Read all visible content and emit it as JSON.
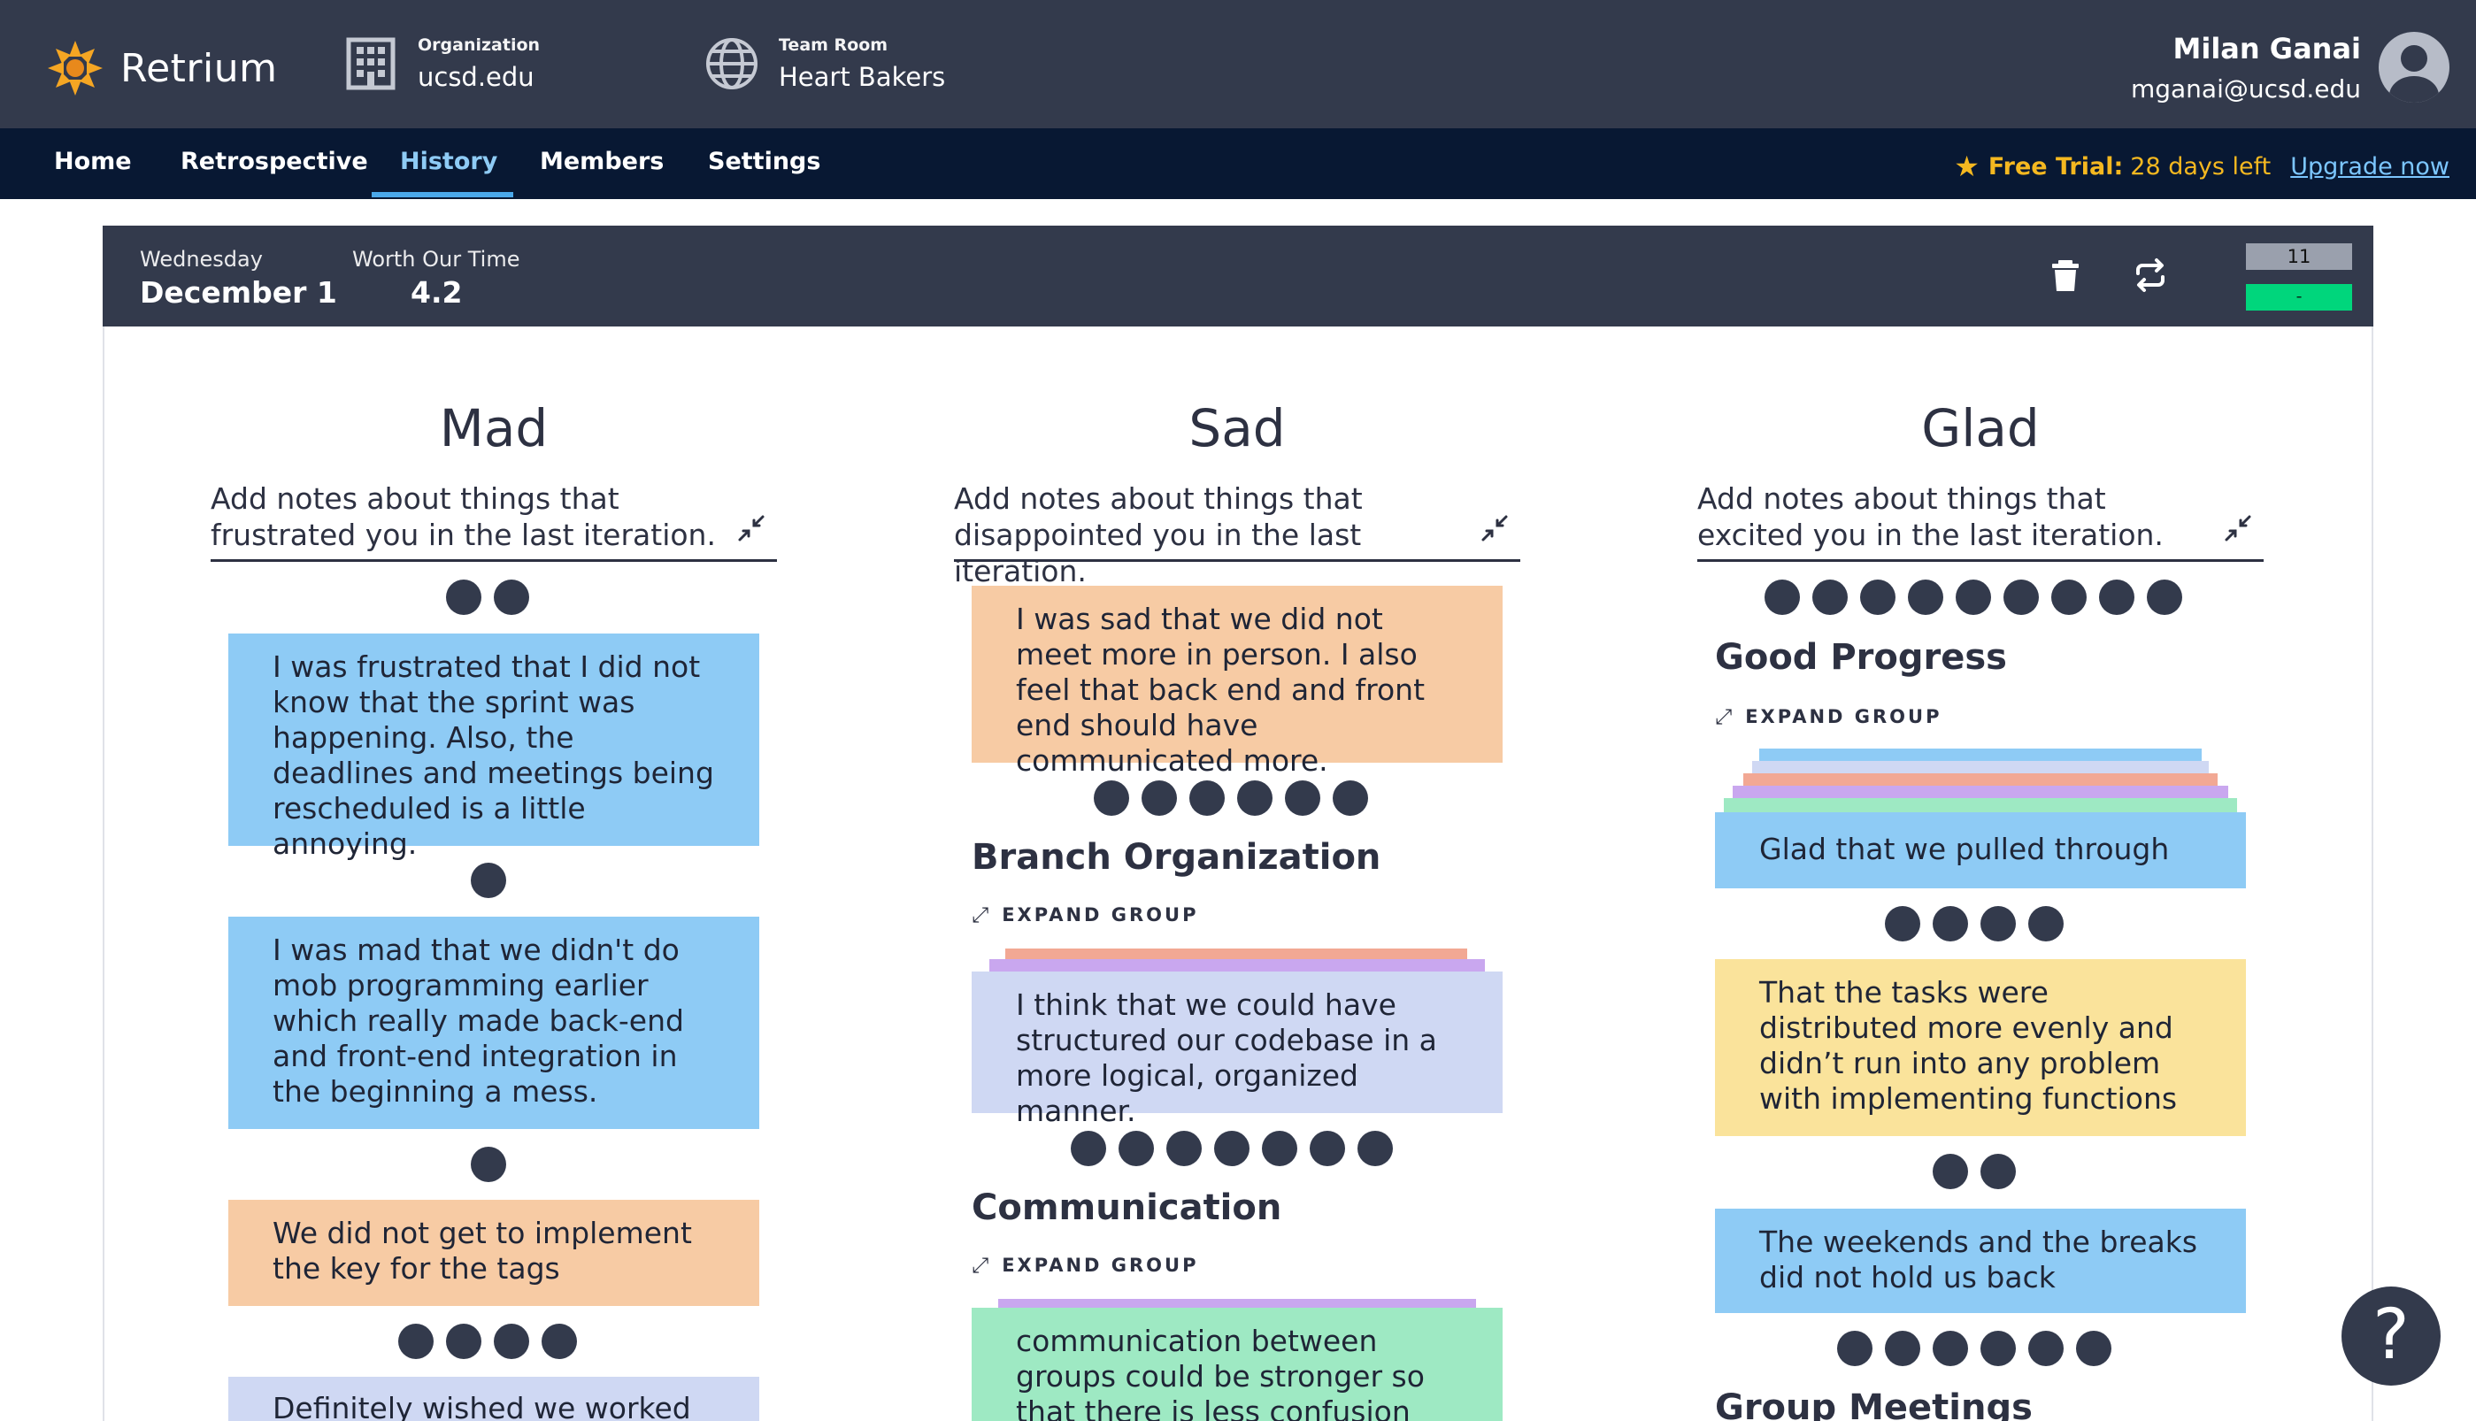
{
  "app": {
    "name": "Retrium"
  },
  "org": {
    "label": "Organization",
    "value": "ucsd.edu"
  },
  "team": {
    "label": "Team Room",
    "value": "Heart Bakers"
  },
  "user": {
    "name": "Milan Ganai",
    "email": "mganai@ucsd.edu"
  },
  "nav": {
    "items": [
      "Home",
      "Retrospective",
      "History",
      "Members",
      "Settings"
    ],
    "active": "History"
  },
  "trial": {
    "label": "Free Trial:",
    "days": "28 days left",
    "upgrade": "Upgrade now"
  },
  "retro": {
    "day": "Wednesday",
    "date": "December 1",
    "worth_label": "Worth Our Time",
    "worth_value": "4.2",
    "count": "11",
    "status": "-"
  },
  "columns": {
    "mad": {
      "title": "Mad",
      "desc": "Add notes about things that frustrated you in the last iteration.",
      "cards": [
        "I was frustrated that I did not know that the sprint was happening. Also, the deadlines and meetings being rescheduled is a little annoying.",
        "I was mad that we didn't do mob programming earlier which really made back-end and front-end integration in the beginning a mess.",
        "We did not get to implement the key for the tags",
        "Definitely wished we worked on"
      ]
    },
    "sad": {
      "title": "Sad",
      "desc": "Add notes about things that disappointed you in the last iteration.",
      "cards": [
        "I was sad that we did not meet more in person. I also feel that back end and front end should have communicated more.",
        "I think that we could have structured our codebase in a more logical, organized manner.",
        "communication between groups could be stronger so that there is less confusion"
      ],
      "groups": [
        "Branch Organization",
        "Communication"
      ]
    },
    "glad": {
      "title": "Glad",
      "desc": "Add notes about things that excited you in the last iteration.",
      "cards": [
        "Glad that we pulled through",
        "That the tasks were distributed more evenly and didn’t run into any problem with implementing functions",
        "The weekends and the breaks did not hold us back"
      ],
      "groups": [
        "Good Progress",
        "Group Meetings"
      ]
    }
  },
  "expand_label": "EXPAND GROUP",
  "help": "?",
  "colors": {
    "header": "#333a4c",
    "nav": "#081833",
    "blue": "#8ecbf5",
    "peach": "#f7cba4",
    "lavender": "#cfd8f3",
    "yellow": "#fae39b",
    "mint": "#9ee9c3",
    "accent": "#f5b820"
  }
}
